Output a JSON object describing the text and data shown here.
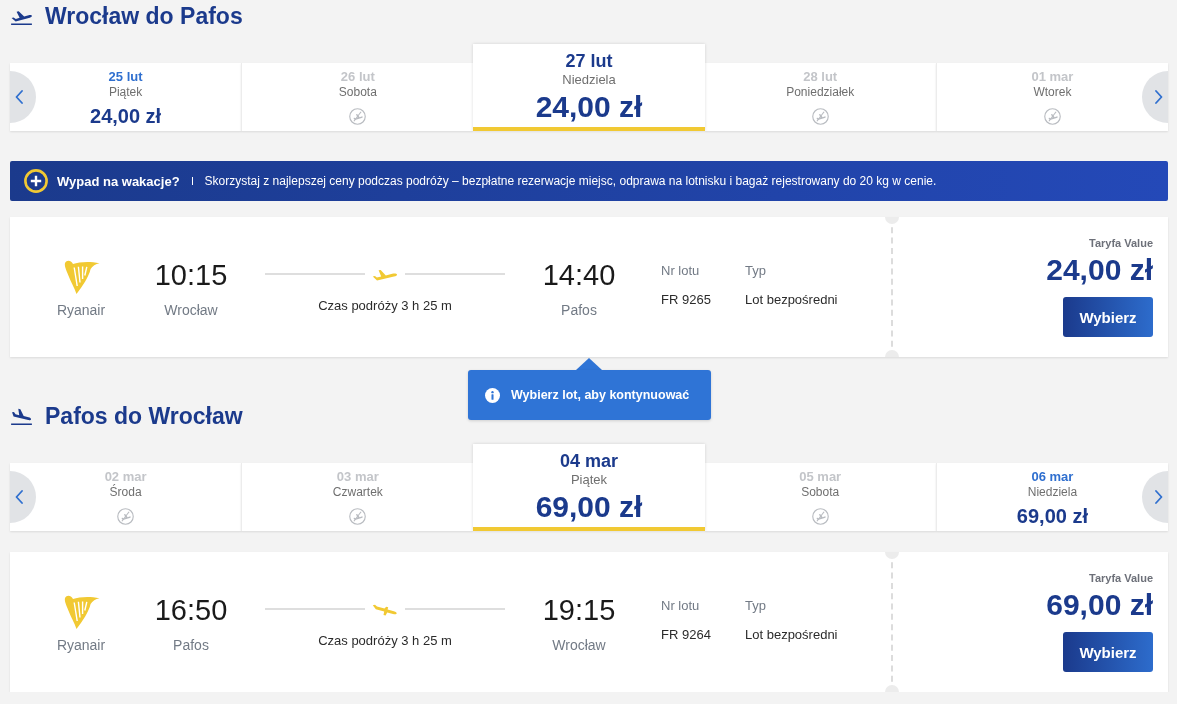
{
  "sections": [
    {
      "kind": "departure",
      "title": "Wrocław do Pafos",
      "dates": [
        {
          "date": "25 lut",
          "weekday": "Piątek",
          "available": true,
          "price": "24,00 zł",
          "selected": false
        },
        {
          "date": "26 lut",
          "weekday": "Sobota",
          "available": false,
          "selected": false
        },
        {
          "date": "27 lut",
          "weekday": "Niedziela",
          "available": true,
          "price": "24,00 zł",
          "selected": true
        },
        {
          "date": "28 lut",
          "weekday": "Poniedziałek",
          "available": false,
          "selected": false
        },
        {
          "date": "01 mar",
          "weekday": "Wtorek",
          "available": false,
          "selected": false
        }
      ],
      "banner": {
        "headline": "Wypad na wakacje?",
        "text": "Skorzystaj z najlepszej ceny podczas podróży – bezpłatne rezerwacje miejsc, odprawa na lotnisku i bagaż rejestrowany do 20 kg w cenie."
      },
      "flights": [
        {
          "airline": "Ryanair",
          "departure_time": "10:15",
          "departure_city": "Wrocław",
          "duration": "Czas podróży 3 h 25 m",
          "arrival_time": "14:40",
          "arrival_city": "Pafos",
          "flight_number_label": "Nr lotu",
          "flight_number": "FR 9265",
          "type_label": "Typ",
          "flight_type": "Lot bezpośredni",
          "fare_name": "Taryfa Value",
          "price": "24,00 zł",
          "button": "Wybierz"
        }
      ],
      "tooltip": "Wybierz lot, aby kontynuować"
    },
    {
      "kind": "return",
      "title": "Pafos do Wrocław",
      "dates": [
        {
          "date": "02 mar",
          "weekday": "Środa",
          "available": false,
          "selected": false
        },
        {
          "date": "03 mar",
          "weekday": "Czwartek",
          "available": false,
          "selected": false
        },
        {
          "date": "04 mar",
          "weekday": "Piątek",
          "available": true,
          "price": "69,00 zł",
          "selected": true
        },
        {
          "date": "05 mar",
          "weekday": "Sobota",
          "available": false,
          "selected": false
        },
        {
          "date": "06 mar",
          "weekday": "Niedziela",
          "available": true,
          "price": "69,00 zł",
          "selected": false
        }
      ],
      "flights": [
        {
          "airline": "Ryanair",
          "departure_time": "16:50",
          "departure_city": "Pafos",
          "duration": "Czas podróży 3 h 25 m",
          "arrival_time": "19:15",
          "arrival_city": "Wrocław",
          "flight_number_label": "Nr lotu",
          "flight_number": "FR 9264",
          "type_label": "Typ",
          "flight_type": "Lot bezpośredni",
          "fare_name": "Taryfa Value",
          "price": "69,00 zł",
          "button": "Wybierz"
        }
      ]
    }
  ]
}
